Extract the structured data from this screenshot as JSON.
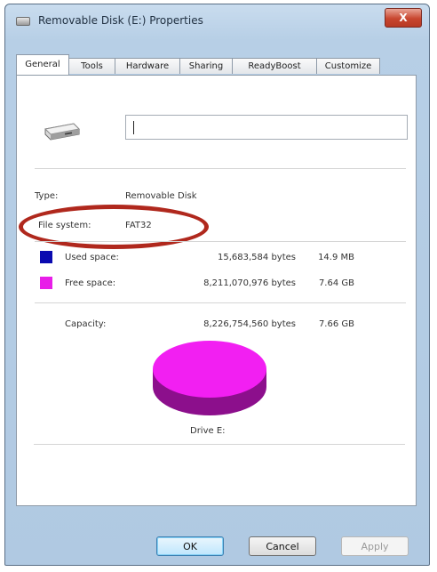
{
  "window": {
    "title": "Removable Disk (E:) Properties",
    "close_label": "X"
  },
  "tabs": [
    {
      "label": "General",
      "active": true
    },
    {
      "label": "Tools"
    },
    {
      "label": "Hardware"
    },
    {
      "label": "Sharing"
    },
    {
      "label": "ReadyBoost"
    },
    {
      "label": "Customize"
    }
  ],
  "general": {
    "volume_name_value": "",
    "type_label": "Type:",
    "type_value": "Removable Disk",
    "fs_label": "File system:",
    "fs_value": "FAT32"
  },
  "space": {
    "used": {
      "label": "Used space:",
      "bytes": "15,683,584 bytes",
      "human": "14.9 MB",
      "color": "#0a0ab0"
    },
    "free": {
      "label": "Free space:",
      "bytes": "8,211,070,976 bytes",
      "human": "7.64 GB",
      "color": "#e81ee8"
    },
    "capacity": {
      "label": "Capacity:",
      "bytes": "8,226,754,560 bytes",
      "human": "7.66 GB"
    }
  },
  "drive_label": "Drive E:",
  "buttons": {
    "ok": "OK",
    "cancel": "Cancel",
    "apply": "Apply"
  },
  "colors": {
    "highlight": "#b0281d",
    "pie_top": "#f21ff2",
    "pie_side": "#8c0f8c"
  }
}
